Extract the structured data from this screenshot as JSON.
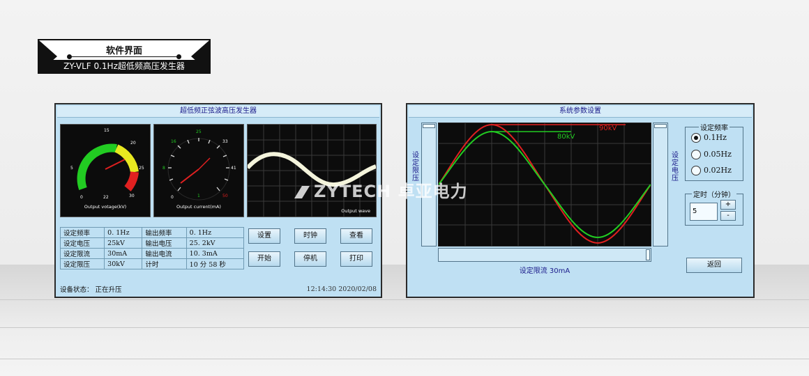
{
  "badge": {
    "title": "软件界面",
    "subtitle": "ZY-VLF 0.1Hz超低频高压发生器"
  },
  "left_panel": {
    "title": "超低频正弦波高压发生器",
    "gauges": [
      {
        "label": "Output votage(kV)",
        "ticks": [
          "0",
          "5",
          "15",
          "20",
          "25",
          "30",
          "22"
        ],
        "needle_value": 22,
        "max": 30
      },
      {
        "label": "Output current(mA)",
        "ticks": [
          "0",
          "8",
          "16",
          "25",
          "33",
          "41",
          "50",
          "1"
        ],
        "needle_value": 1,
        "max": 50
      }
    ],
    "wave_label": "Output wave",
    "params": [
      [
        "设定频率",
        "0. 1Hz",
        "输出频率",
        "0. 1Hz"
      ],
      [
        "设定电压",
        "25kV",
        "输出电压",
        "25. 2kV"
      ],
      [
        "设定限流",
        "30mA",
        "输出电流",
        "10. 3mA"
      ],
      [
        "设定限压",
        "30kV",
        "计时",
        "10 分 58 秒"
      ]
    ],
    "buttons": {
      "settings": "设置",
      "clock": "时钟",
      "view": "查看",
      "start": "开始",
      "stop": "停机",
      "print": "打印"
    },
    "status": "设备状态： 正在升压",
    "datetime": "12:14:30  2020/02/08"
  },
  "right_panel": {
    "title": "系统参数设置",
    "left_slider_label": "设定限压",
    "right_slider_label": "设定电压",
    "red_label": "90kV",
    "green_label": "80kV",
    "current_limit_label": "设定限流  30mA",
    "freq_group": {
      "title": "设定频率",
      "options": [
        "0.1Hz",
        "0.05Hz",
        "0.02Hz"
      ],
      "selected": 0
    },
    "timer_group": {
      "title": "定时（分钟）",
      "value": "5",
      "plus": "+",
      "minus": "-"
    },
    "back_button": "返回"
  },
  "watermark": "ZYTECH 卓亚电力",
  "colors": {
    "panel_bg": "#bfe0f3",
    "title_text": "#1a1a8a",
    "green": "#22cc22",
    "red": "#e02020",
    "yellow": "#e8e820"
  }
}
